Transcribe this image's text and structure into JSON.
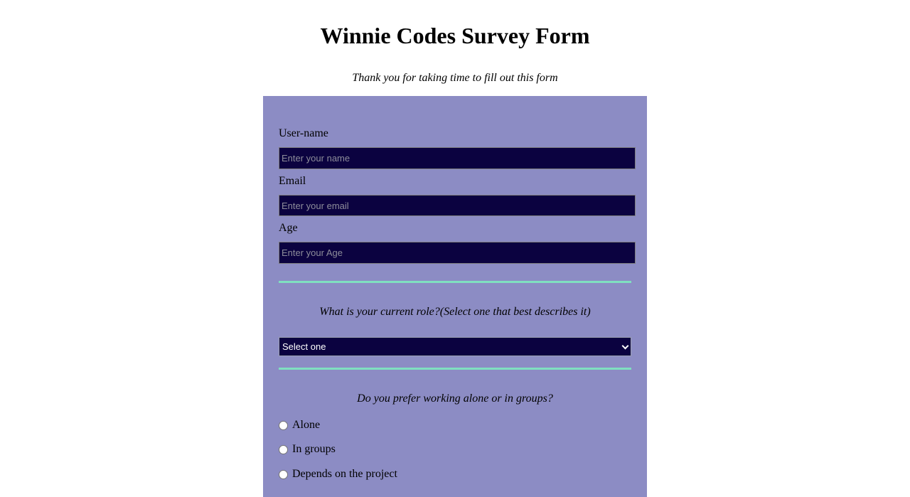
{
  "header": {
    "title": "Winnie Codes Survey Form",
    "subtitle": "Thank you for taking time to fill out this form"
  },
  "form": {
    "username": {
      "label": "User-name",
      "placeholder": "Enter your name",
      "value": ""
    },
    "email": {
      "label": "Email",
      "placeholder": "Enter your email",
      "value": ""
    },
    "age": {
      "label": "Age",
      "placeholder": "Enter your Age",
      "value": ""
    },
    "role": {
      "question": "What is your current role?(Select one that best describes it)",
      "selected": "Select one"
    },
    "work_preference": {
      "question": "Do you prefer working alone or in groups?",
      "options": [
        {
          "label": "Alone",
          "checked": false
        },
        {
          "label": "In groups",
          "checked": false
        },
        {
          "label": "Depends on the project",
          "checked": false
        }
      ]
    }
  },
  "colors": {
    "panel_background": "#8c8cc4",
    "input_background": "#0b0240",
    "divider": "#7fe0c0"
  }
}
